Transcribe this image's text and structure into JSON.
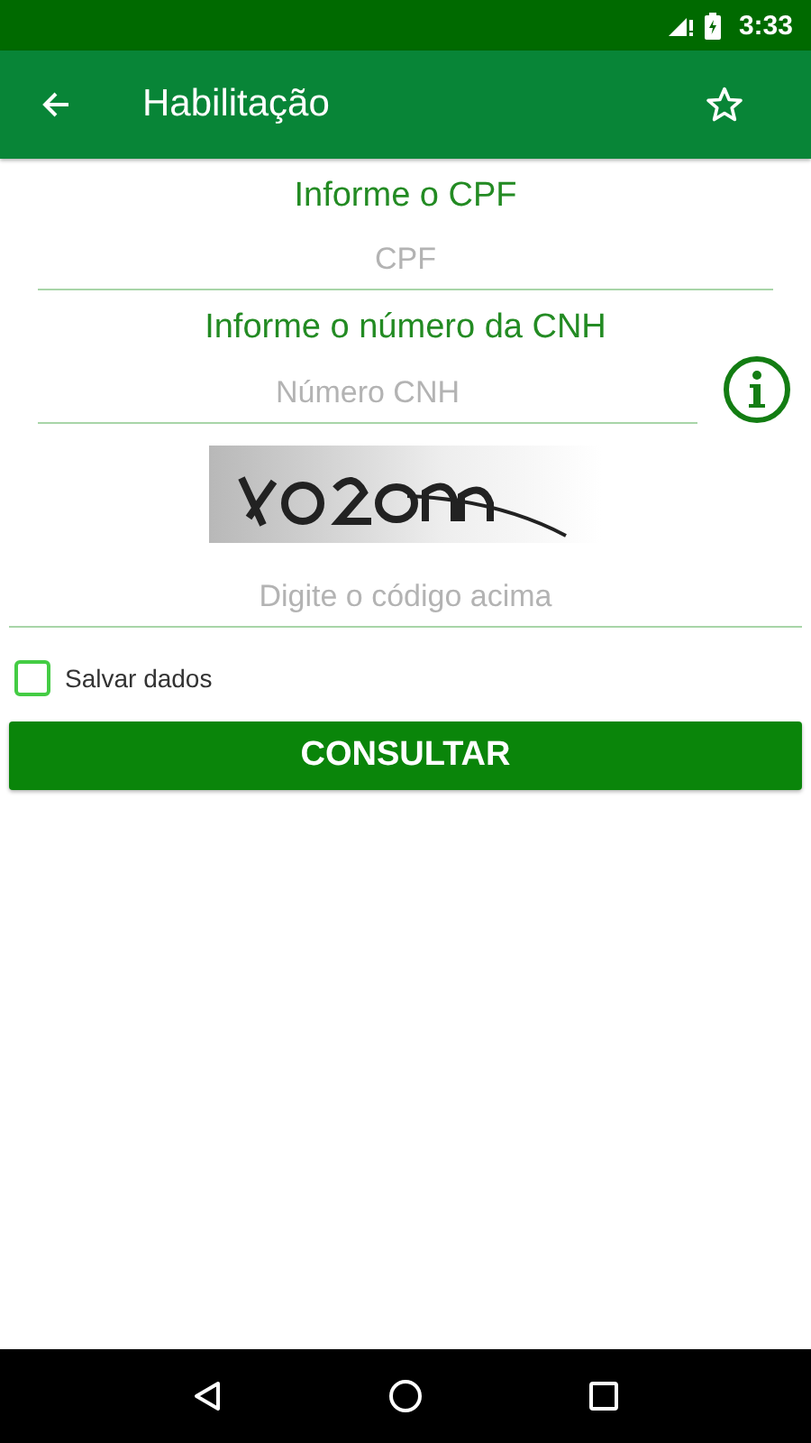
{
  "status_bar": {
    "time": "3:33"
  },
  "app_bar": {
    "title": "Habilitação"
  },
  "form": {
    "cpf_label": "Informe o CPF",
    "cpf_field": {
      "placeholder": "CPF"
    },
    "cnh_label": "Informe o número da CNH",
    "cnh_field": {
      "placeholder": "Número CNH"
    },
    "code_field": {
      "placeholder": "Digite o código acima"
    },
    "save_data": {
      "label": "Salvar dados",
      "checked": false
    },
    "submit": "CONSULTAR"
  }
}
